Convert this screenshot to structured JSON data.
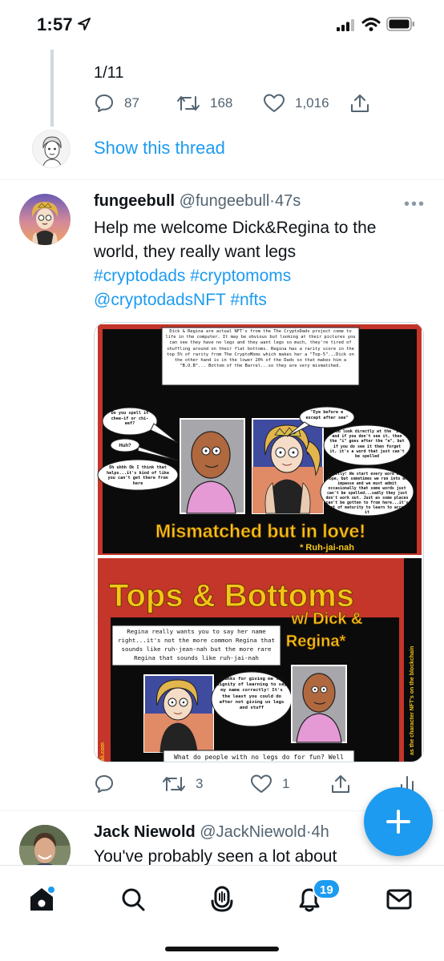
{
  "status_bar": {
    "time": "1:57"
  },
  "previous_tweet": {
    "thread_count": "1/11",
    "reply_count": "87",
    "retweet_count": "168",
    "like_count": "1,016",
    "show_thread": "Show this thread"
  },
  "tweet": {
    "name": "fungeebull",
    "handle": "@fungeebull",
    "separator": "·",
    "time": "47s",
    "more": "•••",
    "text_line1": "Help me welcome Dick&Regina to the",
    "text_line2": "world, they really want legs",
    "hashtags_line": [
      "#cryptodads",
      "#cryptomoms"
    ],
    "mention": "@cryptodadsNFT",
    "hashtag_nfts": "#nfts",
    "reply_count": "",
    "retweet_count": "3",
    "like_count": "1",
    "media": {
      "panel1_caption": "Dick & Regina are actual NFT's from the The CryptoDads project come to life in the computer. It may be obvious but looking at their pictures you can see they have no legs and they want legs so much, they're tired of shuffling around on their flat bottoms. Regina has a rarity score in the top 5% of rarity from The CryptoMoms which makes her a \"Top-5\"...Dick on the other hand is in the lower 20% of the Dads so that makes him a \"B.O.B\"... Bottom of the Barrel...so they are very mismatched.",
      "bubble_do_you": "Do you spell it chee-if or chi-eef?",
      "bubble_huh": "Huh?",
      "bubble_oh": "Oh uhhh Ok I think that helps...it's kind of like you can't get there from here",
      "bubble_eye": "\"Eye before e except after see\"",
      "bubble_look": "You look directly at the \"i\" and if you don't see it, then the \"i\" goes after the \"e\", but if you do see it then forget it, it's a word that just can't be spelled",
      "bubble_exactly": "Exactly! We start every word with hope, but sometimes we run into an impasse and we must admit occasionally that some words just can't be spelled...sadly they just don't work out. Just as some places can't be gotten to from here...it's part of maturity to learn to accept it",
      "mismatched_title": "Mismatched but in love!",
      "ruh_jai_nah": "* Ruh-jai-nah",
      "tops_title": "Tops & Bottoms",
      "w_dick": "w/ Dick &",
      "regina": "Regina*",
      "panel2_caption": "Regina really wants you to say her name right...it's not the more common Regina that sounds like ruh-jean-nah but the more rare Regina that sounds like ruh-jai-nah",
      "bubble_thanks": "Thanks for giving me the dignity of learning to say my name correctly! It's the least you could do after not giving us legs and stuff",
      "bottom_caption": "What do people with no legs do for fun? Well",
      "side_text": "as the character NFT's on the blockchain",
      "left_side_text": "ali.com"
    }
  },
  "next_tweet": {
    "name": "Jack Niewold",
    "handle": "@JackNiewold",
    "separator": "·",
    "time": "4h",
    "text": "You've probably seen a lot about"
  },
  "tab_bar": {
    "notifications_badge": "19"
  },
  "colors": {
    "accent": "#1d9bf0",
    "muted": "#536471",
    "comic_red": "#c4352a",
    "comic_yellow": "#f5c518"
  }
}
